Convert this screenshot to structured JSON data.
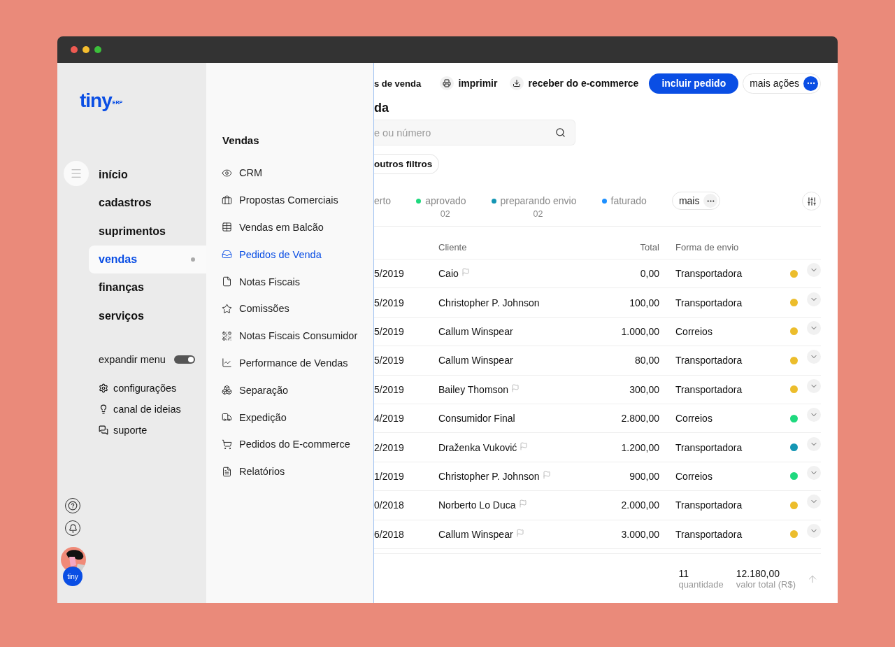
{
  "logo": {
    "name": "tiny",
    "suffix": "ERP"
  },
  "nav": [
    {
      "label": "início",
      "selected": false
    },
    {
      "label": "cadastros",
      "selected": false
    },
    {
      "label": "suprimentos",
      "selected": false
    },
    {
      "label": "vendas",
      "selected": true
    },
    {
      "label": "finanças",
      "selected": false
    },
    {
      "label": "serviços",
      "selected": false
    }
  ],
  "expand_menu": {
    "label": "expandir menu",
    "on": true
  },
  "links": [
    "configurações",
    "canal de ideias",
    "suporte"
  ],
  "account": {
    "badge": "tiny"
  },
  "submenu": {
    "title": "Vendas",
    "items": [
      {
        "label": "CRM",
        "selected": false
      },
      {
        "label": "Propostas Comerciais",
        "selected": false
      },
      {
        "label": "Vendas em Balcão",
        "selected": false
      },
      {
        "label": "Pedidos de Venda",
        "selected": true
      },
      {
        "label": "Notas Fiscais",
        "selected": false
      },
      {
        "label": "Comissões",
        "selected": false
      },
      {
        "label": "Notas Fiscais Consumidor",
        "selected": false
      },
      {
        "label": "Performance de Vendas",
        "selected": false
      },
      {
        "label": "Separação",
        "selected": false
      },
      {
        "label": "Expedição",
        "selected": false
      },
      {
        "label": "Pedidos do E-commerce",
        "selected": false
      },
      {
        "label": "Relatórios",
        "selected": false
      }
    ]
  },
  "toolbar": {
    "breadcrumb": "s de venda",
    "print": "imprimir",
    "receive": "receber do e-commerce",
    "primary": "incluir pedido",
    "more": "mais ações"
  },
  "title": "da",
  "search": {
    "placeholder": "e ou número"
  },
  "filters": "outros filtros",
  "status_tabs": [
    {
      "label": "erto"
    },
    {
      "label": "aprovado",
      "color": "#1ed97e",
      "count": "02"
    },
    {
      "label": "preparando envio",
      "color": "#1496b4",
      "count": "02"
    },
    {
      "label": "faturado",
      "color": "#1e90ff"
    }
  ],
  "more_tabs": "mais",
  "table": {
    "columns": [
      "Cliente",
      "Total",
      "Forma de envio"
    ],
    "rows": [
      {
        "date": "5/2019",
        "client": "Caio",
        "flagged": true,
        "total": "0,00",
        "shipping": "Transportadora",
        "color": "#ecbd2c"
      },
      {
        "date": "5/2019",
        "client": "Christopher P. Johnson",
        "flagged": false,
        "total": "100,00",
        "shipping": "Transportadora",
        "color": "#ecbd2c"
      },
      {
        "date": "5/2019",
        "client": "Callum Winspear",
        "flagged": false,
        "total": "1.000,00",
        "shipping": "Correios",
        "color": "#ecbd2c"
      },
      {
        "date": "5/2019",
        "client": "Callum Winspear",
        "flagged": false,
        "total": "80,00",
        "shipping": "Transportadora",
        "color": "#ecbd2c"
      },
      {
        "date": "5/2019",
        "client": "Bailey Thomson",
        "flagged": true,
        "total": "300,00",
        "shipping": "Transportadora",
        "color": "#ecbd2c"
      },
      {
        "date": "4/2019",
        "client": "Consumidor Final",
        "flagged": false,
        "total": "2.800,00",
        "shipping": "Correios",
        "color": "#1ed97e"
      },
      {
        "date": "2/2019",
        "client": "Draženka Vuković",
        "flagged": true,
        "total": "1.200,00",
        "shipping": "Transportadora",
        "color": "#1496b4"
      },
      {
        "date": "1/2019",
        "client": "Christopher P. Johnson",
        "flagged": true,
        "total": "900,00",
        "shipping": "Correios",
        "color": "#1ed97e"
      },
      {
        "date": "0/2018",
        "client": "Norberto Lo Duca",
        "flagged": true,
        "total": "2.000,00",
        "shipping": "Transportadora",
        "color": "#ecbd2c"
      },
      {
        "date": "6/2018",
        "client": "Callum Winspear",
        "flagged": true,
        "total": "3.000,00",
        "shipping": "Transportadora",
        "color": "#ecbd2c"
      }
    ]
  },
  "summary": {
    "quantity": "11",
    "quantity_label": "quantidade",
    "total": "12.180,00",
    "total_label": "valor total (R$)"
  }
}
